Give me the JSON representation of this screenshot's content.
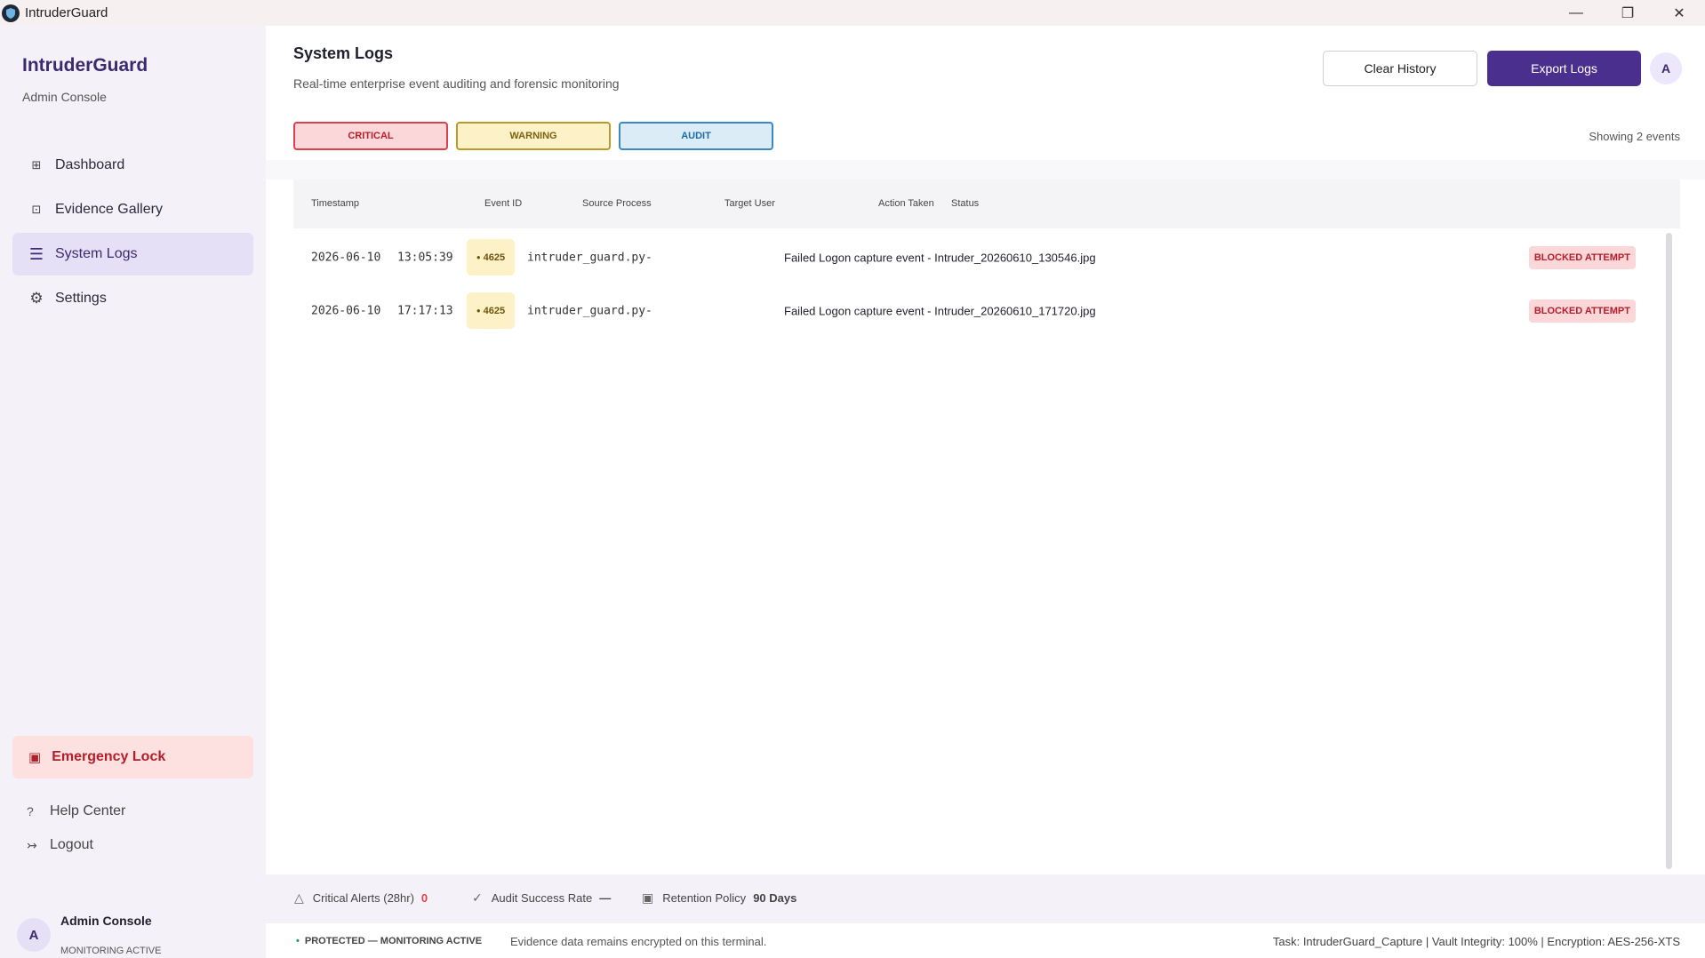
{
  "window": {
    "title": "IntruderGuard"
  },
  "sidebar": {
    "brand": "IntruderGuard",
    "subtitle": "Admin Console",
    "items": [
      {
        "label": "Dashboard",
        "icon": "grid-icon"
      },
      {
        "label": "Evidence Gallery",
        "icon": "gallery-icon"
      },
      {
        "label": "System Logs",
        "icon": "list-icon",
        "active": true
      },
      {
        "label": "Settings",
        "icon": "gear-icon"
      }
    ],
    "emergency_label": "Emergency Lock",
    "help_label": "Help Center",
    "logout_label": "Logout",
    "profile": {
      "initial": "A",
      "name": "Admin Console",
      "status": "MONITORING ACTIVE"
    }
  },
  "header": {
    "title": "System Logs",
    "subtitle": "Real-time enterprise event auditing and forensic monitoring",
    "clear_label": "Clear History",
    "export_label": "Export Logs",
    "avatar_initial": "A"
  },
  "filters": {
    "critical": "CRITICAL",
    "warning": "WARNING",
    "audit": "AUDIT",
    "showing": "Showing 2 events"
  },
  "table": {
    "headers": {
      "timestamp": "Timestamp",
      "event_id": "Event ID",
      "source": "Source Process",
      "user": "Target User",
      "action": "Action Taken",
      "status": "Status"
    },
    "rows": [
      {
        "date": "2026-06-10",
        "time": "13:05:39",
        "event_id": "4625",
        "source": "intruder_guard.py-",
        "action": "Failed Logon capture event - Intruder_20260610_130546.jpg",
        "status": "BLOCKED ATTEMPT"
      },
      {
        "date": "2026-06-10",
        "time": "17:17:13",
        "event_id": "4625",
        "source": "intruder_guard.py-",
        "action": "Failed Logon capture event - Intruder_20260610_171720.jpg",
        "status": "BLOCKED ATTEMPT"
      }
    ]
  },
  "stats": {
    "critical_label": "Critical Alerts (28hr)",
    "critical_value": "0",
    "audit_label": "Audit Success Rate",
    "audit_value": "—",
    "retention_label": "Retention Policy",
    "retention_value": "90 Days"
  },
  "footer": {
    "protected": "PROTECTED — MONITORING ACTIVE",
    "message": "Evidence data remains encrypted on this terminal.",
    "meta": "Task: IntruderGuard_Capture | Vault Integrity: 100% | Encryption: AES-256-XTS"
  },
  "colors": {
    "accent": "#4b2f8f",
    "critical": "#d9414b",
    "warning": "#b99a2c",
    "audit": "#3b89c2",
    "sidebar_bg": "#f4f2f8"
  }
}
